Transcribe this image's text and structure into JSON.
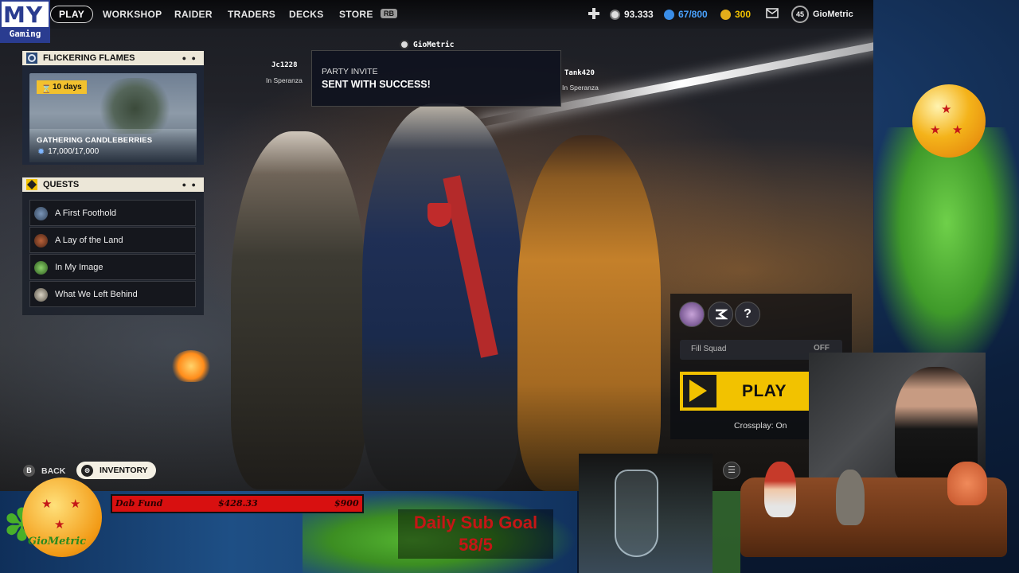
{
  "brand": {
    "logo_top": "MY",
    "logo_bottom": "Gaming"
  },
  "nav": {
    "items": [
      "PLAY",
      "WORKSHOP",
      "RAIDER",
      "TRADERS",
      "DECKS",
      "STORE"
    ],
    "store_badge": "RB"
  },
  "currency": {
    "coins": "93.333",
    "seeds": "67/800",
    "gold": "300",
    "level": "45",
    "username": "GioMetric"
  },
  "event": {
    "header": "FLICKERING FLAMES",
    "timer": "10 days",
    "title": "GATHERING CANDLEBERRIES",
    "progress": "17,000/17,000"
  },
  "quests": {
    "header": "QUESTS",
    "items": [
      "A First Foothold",
      "A Lay of the Land",
      "In My Image",
      "What We Left Behind"
    ]
  },
  "party": {
    "leader": "GioMetric",
    "left_name": "Jc1228",
    "left_location": "In Speranza",
    "right_name": "Tank420",
    "right_location": "In Speranza"
  },
  "toast": {
    "title": "PARTY INVITE",
    "message": "SENT WITH SUCCESS!"
  },
  "play_panel": {
    "question_label": "?",
    "fill_squad_label": "Fill Squad",
    "fill_squad_state": "OFF",
    "play_label": "PLAY",
    "crossplay": "Crossplay: On"
  },
  "bottom_buttons": {
    "back_key": "B",
    "back_label": "BACK",
    "inventory_label": "INVENTORY"
  },
  "overlay": {
    "fund_label": "Dab Fund",
    "fund_current": "$428.33",
    "fund_goal": "$900",
    "sub_goal_title": "Daily Sub Goal",
    "sub_goal_value": "58/5",
    "gio_logo": "GioMetric"
  },
  "colors": {
    "accent_yellow": "#f2c200",
    "fund_red": "#d81010",
    "panel_header": "#ece7d8"
  },
  "icons": {
    "event": "gear-icon",
    "quests": "diamond-quest-icon",
    "timer": "hourglass-icon",
    "progress": "seed-icon",
    "mail": "mail-icon",
    "gamepad": "controller-icon"
  }
}
